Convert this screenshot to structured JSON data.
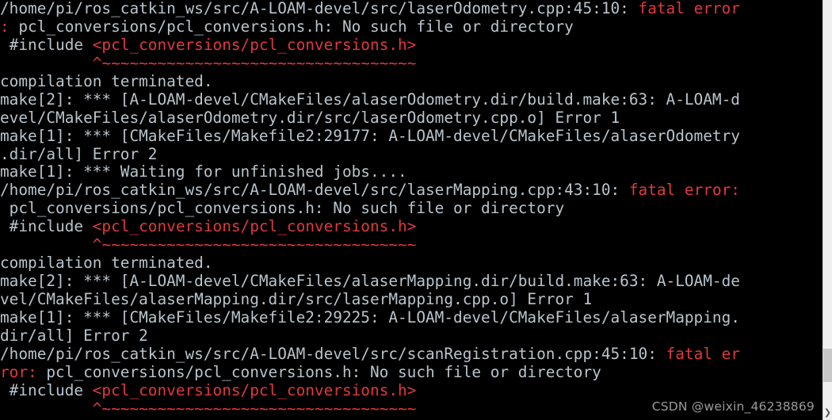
{
  "terminal": {
    "background_color": "#000000",
    "default_text_color": "#b9c4cc",
    "error_text_color": "#e0393c",
    "lines": [
      {
        "segments": [
          {
            "text": "/home/pi/ros_catkin_ws/src/A-LOAM-devel/src/laserOdometry.cpp:45:10: ",
            "color": "default"
          },
          {
            "text": "fatal error",
            "color": "red"
          }
        ]
      },
      {
        "segments": [
          {
            "text": ":",
            "color": "red"
          },
          {
            "text": " pcl_conversions/pcl_conversions.h: No such file or directory",
            "color": "default"
          }
        ]
      },
      {
        "segments": [
          {
            "text": " #include ",
            "color": "default"
          },
          {
            "text": "<pcl_conversions/pcl_conversions.h>",
            "color": "red"
          }
        ]
      },
      {
        "segments": [
          {
            "text": "          ^~~~~~~~~~~~~~~~~~~~~~~~~~~~~~~~~~~",
            "color": "red"
          }
        ]
      },
      {
        "segments": [
          {
            "text": "compilation terminated.",
            "color": "default"
          }
        ]
      },
      {
        "segments": [
          {
            "text": "make[2]: *** [A-LOAM-devel/CMakeFiles/alaserOdometry.dir/build.make:63: A-LOAM-d",
            "color": "default"
          }
        ]
      },
      {
        "segments": [
          {
            "text": "evel/CMakeFiles/alaserOdometry.dir/src/laserOdometry.cpp.o] Error 1",
            "color": "default"
          }
        ]
      },
      {
        "segments": [
          {
            "text": "make[1]: *** [CMakeFiles/Makefile2:29177: A-LOAM-devel/CMakeFiles/alaserOdometry",
            "color": "default"
          }
        ]
      },
      {
        "segments": [
          {
            "text": ".dir/all] Error 2",
            "color": "default"
          }
        ]
      },
      {
        "segments": [
          {
            "text": "make[1]: *** Waiting for unfinished jobs....",
            "color": "default"
          }
        ]
      },
      {
        "segments": [
          {
            "text": "/home/pi/ros_catkin_ws/src/A-LOAM-devel/src/laserMapping.cpp:43:10: ",
            "color": "default"
          },
          {
            "text": "fatal error:",
            "color": "red"
          }
        ]
      },
      {
        "segments": [
          {
            "text": " pcl_conversions/pcl_conversions.h: No such file or directory",
            "color": "default"
          }
        ]
      },
      {
        "segments": [
          {
            "text": " #include ",
            "color": "default"
          },
          {
            "text": "<pcl_conversions/pcl_conversions.h>",
            "color": "red"
          }
        ]
      },
      {
        "segments": [
          {
            "text": "          ^~~~~~~~~~~~~~~~~~~~~~~~~~~~~~~~~~~",
            "color": "red"
          }
        ]
      },
      {
        "segments": [
          {
            "text": "compilation terminated.",
            "color": "default"
          }
        ]
      },
      {
        "segments": [
          {
            "text": "make[2]: *** [A-LOAM-devel/CMakeFiles/alaserMapping.dir/build.make:63: A-LOAM-de",
            "color": "default"
          }
        ]
      },
      {
        "segments": [
          {
            "text": "vel/CMakeFiles/alaserMapping.dir/src/laserMapping.cpp.o] Error 1",
            "color": "default"
          }
        ]
      },
      {
        "segments": [
          {
            "text": "make[1]: *** [CMakeFiles/Makefile2:29225: A-LOAM-devel/CMakeFiles/alaserMapping.",
            "color": "default"
          }
        ]
      },
      {
        "segments": [
          {
            "text": "dir/all] Error 2",
            "color": "default"
          }
        ]
      },
      {
        "segments": [
          {
            "text": "/home/pi/ros_catkin_ws/src/A-LOAM-devel/src/scanRegistration.cpp:45:10: ",
            "color": "default"
          },
          {
            "text": "fatal er",
            "color": "red"
          }
        ]
      },
      {
        "segments": [
          {
            "text": "ror:",
            "color": "red"
          },
          {
            "text": " pcl_conversions/pcl_conversions.h: No such file or directory",
            "color": "default"
          }
        ]
      },
      {
        "segments": [
          {
            "text": " #include ",
            "color": "default"
          },
          {
            "text": "<pcl_conversions/pcl_conversions.h>",
            "color": "red"
          }
        ]
      },
      {
        "segments": [
          {
            "text": "          ^~~~~~~~~~~~~~~~~~~~~~~~~~~~~~~~~~~",
            "color": "red"
          }
        ]
      }
    ]
  },
  "scrollbar": {
    "track_color": "#f0f0f0",
    "thumb_color": "#c8c8c8",
    "down_arrow_glyph": "❯"
  },
  "watermark": {
    "text": "CSDN @weixin_46238869",
    "color": "#9a9a9a"
  }
}
